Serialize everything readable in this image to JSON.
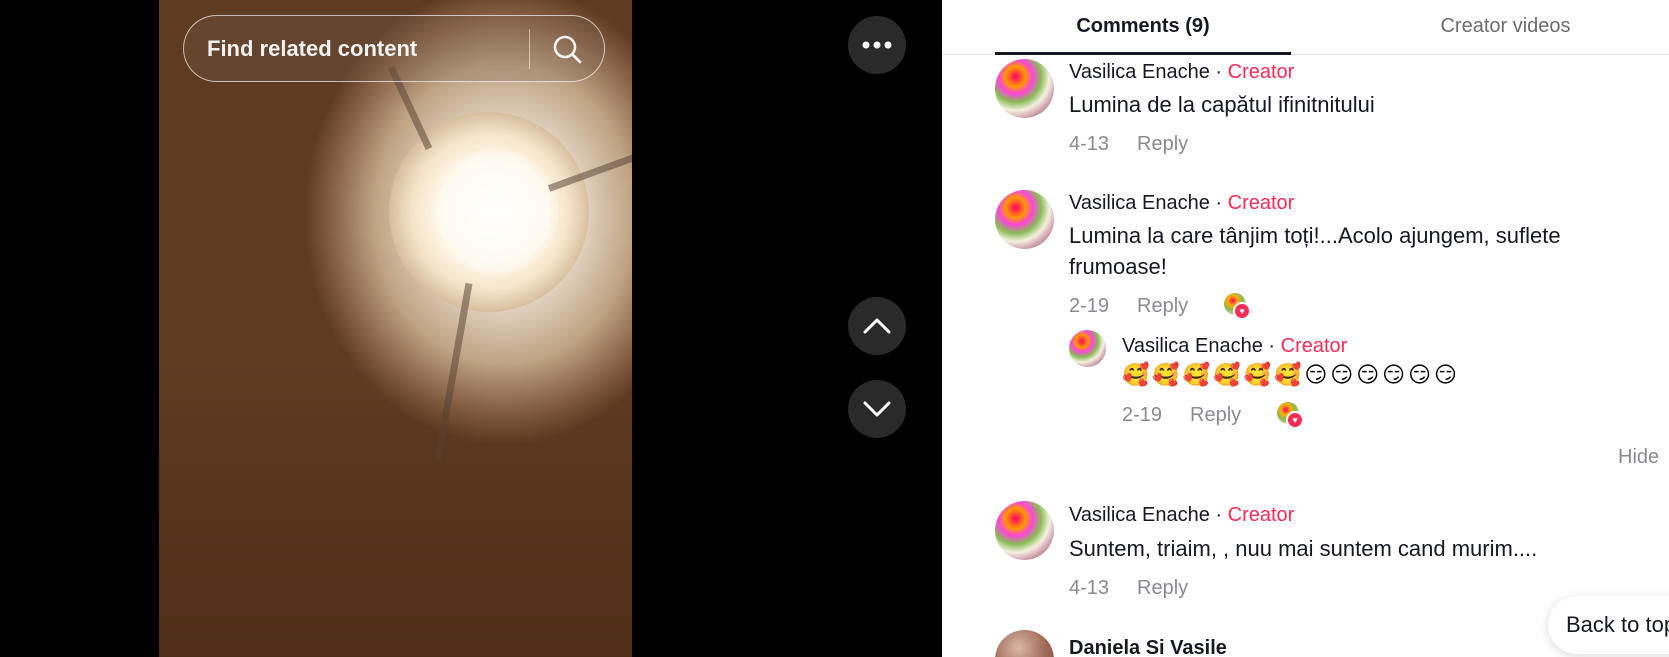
{
  "search": {
    "placeholder": "Find related content"
  },
  "tabs": [
    {
      "label": "Comments (9)",
      "active": true
    },
    {
      "label": "Creator videos",
      "active": false
    }
  ],
  "comments": [
    {
      "author": "Vasilica Enache",
      "badge": "Creator",
      "text": "Lumina de la capătul ifinitnitului",
      "date": "4-13",
      "reply_label": "Reply"
    },
    {
      "author": "Vasilica Enache",
      "badge": "Creator",
      "text": "Lumina la care tânjim toți!...Acolo ajungem, suflete frumoase!",
      "date": "2-19",
      "reply_label": "Reply",
      "liked_by_creator": true,
      "replies": [
        {
          "author": "Vasilica Enache",
          "badge": "Creator",
          "text": "🥰🥰🥰🥰🥰🥰😏😏😏😏😏😏",
          "date": "2-19",
          "reply_label": "Reply",
          "liked_by_creator": true
        }
      ],
      "hide_label": "Hide"
    },
    {
      "author": "Vasilica Enache",
      "badge": "Creator",
      "text": "Suntem, triaim, , nuu mai suntem cand murim....",
      "date": "4-13",
      "reply_label": "Reply"
    },
    {
      "author": "Daniela Si Vasile",
      "badge": "",
      "text": "",
      "date": "",
      "reply_label": ""
    }
  ],
  "separator": "·",
  "back_to_top": "Back to top",
  "icons": {
    "search": "search-icon",
    "more": "more-icon",
    "up": "chevron-up-icon",
    "down": "chevron-down-icon"
  },
  "colors": {
    "creator_badge": "#fe2c55",
    "text": "#161823",
    "muted": "#8a8b91"
  }
}
